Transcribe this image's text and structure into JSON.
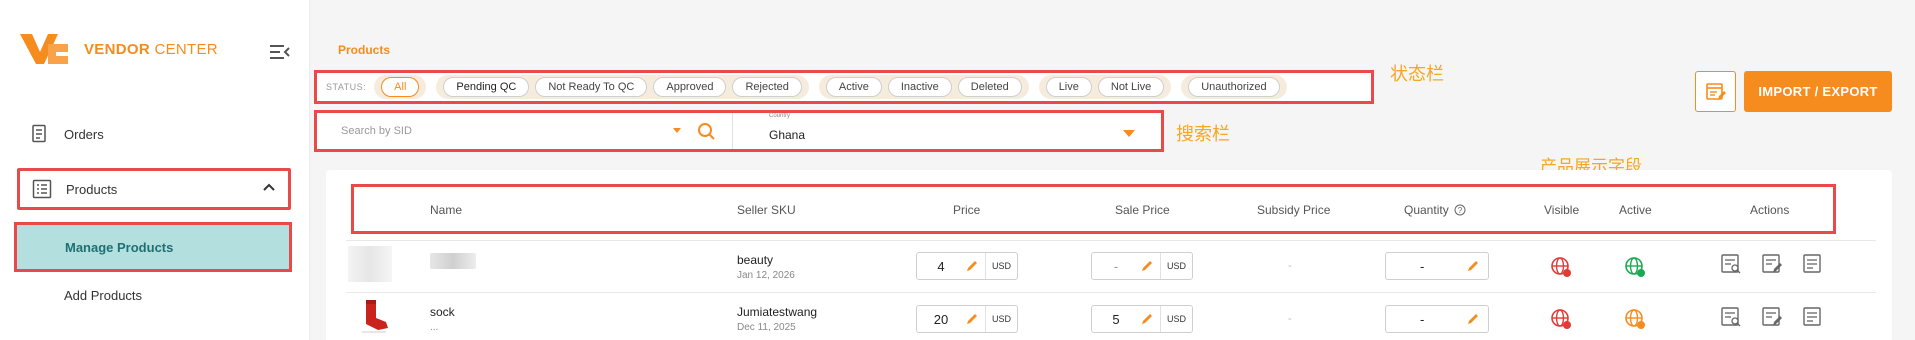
{
  "brand": {
    "name_bold": "VENDOR",
    "name_light": "CENTER",
    "color": "#f68b1e"
  },
  "sidebar": {
    "items": [
      {
        "label": "Orders",
        "icon": "receipt-icon"
      },
      {
        "label": "Products",
        "icon": "list-icon"
      },
      {
        "label": "Manage Products"
      },
      {
        "label": "Add Products"
      }
    ]
  },
  "breadcrumb": "Products",
  "status": {
    "label": "STATUS:",
    "groups": [
      [
        "All"
      ],
      [
        "Pending QC",
        "Not Ready To QC",
        "Approved",
        "Rejected"
      ],
      [
        "Active",
        "Inactive",
        "Deleted"
      ],
      [
        "Live",
        "Not Live"
      ],
      [
        "Unauthorized"
      ]
    ],
    "selected": "All"
  },
  "annotations": {
    "status": "状态栏",
    "search": "搜索栏",
    "fields": "产品展示字段"
  },
  "search": {
    "placeholder": "Search by SID",
    "country_label": "Country",
    "country_value": "Ghana"
  },
  "toolbar": {
    "import_export": "IMPORT / EXPORT"
  },
  "table": {
    "headers": [
      "Name",
      "Seller SKU",
      "Price",
      "Sale Price",
      "Subsidy Price",
      "Quantity",
      "Visible",
      "Active",
      "Actions"
    ],
    "rows": [
      {
        "name": "",
        "name_sub": "",
        "sku": "beauty",
        "date": "Jan 12, 2026",
        "price": "4",
        "currency": "USD",
        "sale": "-",
        "sale_currency": "USD",
        "subsidy": "-",
        "quantity": "-",
        "visible": "red",
        "active": "green"
      },
      {
        "name": "sock",
        "name_sub": "...",
        "sku": "Jumiatestwang",
        "date": "Dec 11, 2025",
        "price": "20",
        "currency": "USD",
        "sale": "5",
        "sale_currency": "USD",
        "subsidy": "-",
        "quantity": "-",
        "visible": "red",
        "active": "orange"
      }
    ]
  },
  "colors": {
    "accent": "#f68b1e",
    "highlight": "#e84a4a",
    "selected_bg": "#b3e0df",
    "green": "#1aaa55",
    "red": "#e53935"
  }
}
